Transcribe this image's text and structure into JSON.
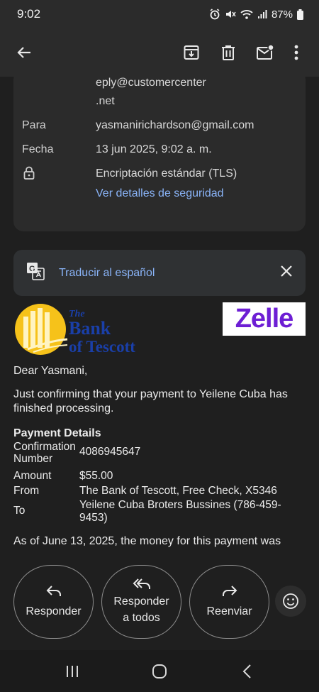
{
  "status": {
    "time": "9:02",
    "battery": "87%"
  },
  "details": {
    "from_partial_1": "eply@customercenter",
    "from_partial_2": ".net",
    "to_label": "Para",
    "to_value": "yasmanirichardson@gmail.com",
    "date_label": "Fecha",
    "date_value": "13 jun 2025, 9:02 a. m.",
    "encryption_value": "Encriptación estándar (TLS)",
    "security_link": "Ver detalles de seguridad"
  },
  "translate": {
    "label": "Traducir al español"
  },
  "email": {
    "bank_logo_line1": "The",
    "bank_logo_line2": "Bank",
    "bank_logo_line3": "of Tescott",
    "zelle_logo": "Zelle",
    "greeting": "Dear Yasmani,",
    "intro": "Just confirming that your payment to Yeilene Cuba has finished processing.",
    "payment_heading": "Payment Details",
    "rows": {
      "confirmation_label_1": "Confirmation",
      "confirmation_label_2": "Number",
      "confirmation_value": "4086945647",
      "amount_label": "Amount",
      "amount_value": "$55.00",
      "from_label": "From",
      "from_value": "The Bank of Tescott, Free Check, X5346",
      "to_label": "To",
      "to_value": "Yeilene Cuba Broters Bussines (786-459-9453)"
    },
    "closing": "As of June 13, 2025, the money for this payment was"
  },
  "actions": {
    "reply": "Responder",
    "reply_all_1": "Responder",
    "reply_all_2": "a todos",
    "forward": "Reenviar"
  }
}
